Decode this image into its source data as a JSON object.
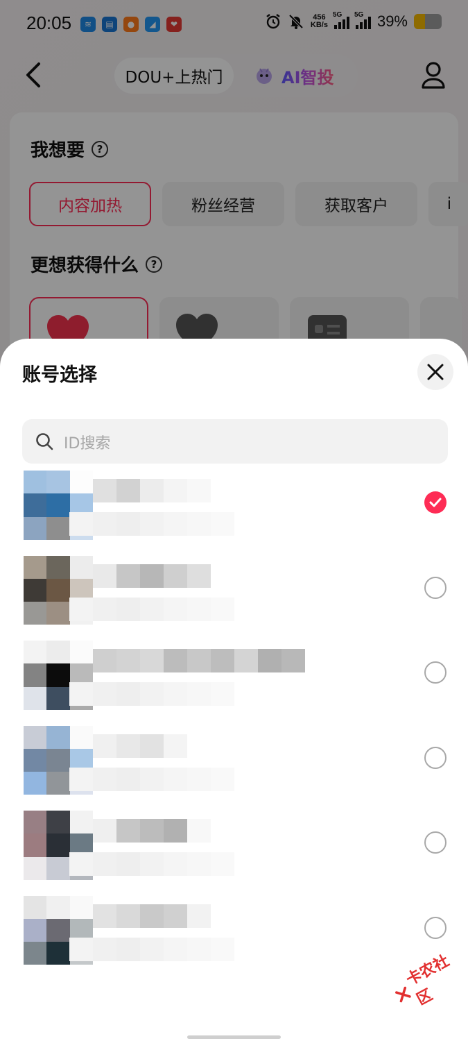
{
  "status_bar": {
    "time": "20:05",
    "net_speed_value": "456",
    "net_speed_unit": "KB/s",
    "signal_1": "5G",
    "signal_2": "5G",
    "battery_percent": "39%",
    "battery_level": 0.39,
    "app_icons": [
      "app-icon-1",
      "app-icon-2",
      "app-icon-3",
      "app-icon-4",
      "app-icon-5"
    ]
  },
  "nav": {
    "tab_dou": "DOU+上热门",
    "tab_ai": "AI智投"
  },
  "goal": {
    "title": "我想要",
    "options": [
      "内容加热",
      "粉丝经营",
      "获取客户",
      "i"
    ],
    "selected_index": 0
  },
  "want": {
    "title": "更想获得什么"
  },
  "sheet": {
    "title": "账号选择",
    "search_placeholder": "ID搜索"
  },
  "accounts": [
    {
      "selected": true
    },
    {
      "selected": false
    },
    {
      "selected": false
    },
    {
      "selected": false
    },
    {
      "selected": false
    },
    {
      "selected": false
    }
  ],
  "watermark": "卡农社区",
  "colors": {
    "accent": "#fe2c55",
    "radio_border": "#a8a8a8",
    "battery": "#f5b800"
  }
}
